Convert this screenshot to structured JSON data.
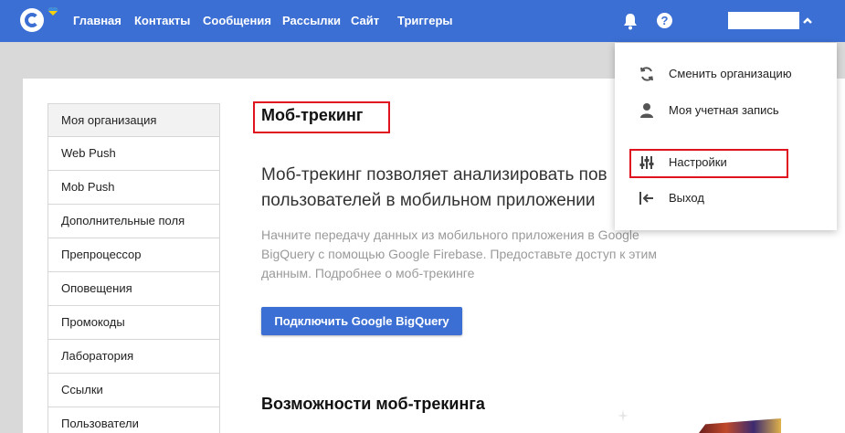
{
  "navbar": {
    "items": [
      {
        "label": "Главная"
      },
      {
        "label": "Контакты"
      },
      {
        "label": "Сообщения"
      },
      {
        "label": "Рассылки"
      },
      {
        "label": "Сайт"
      },
      {
        "label": "Триггеры"
      }
    ],
    "help_glyph": "?",
    "colors": {
      "bar": "#3b6fd4"
    }
  },
  "sidebar": {
    "items": [
      {
        "label": "Моя организация"
      },
      {
        "label": "Web Push"
      },
      {
        "label": "Mob Push"
      },
      {
        "label": "Дополнительные поля"
      },
      {
        "label": "Препроцессор"
      },
      {
        "label": "Оповещения"
      },
      {
        "label": "Промокоды"
      },
      {
        "label": "Лаборатория"
      },
      {
        "label": "Ссылки"
      },
      {
        "label": "Пользователи"
      }
    ]
  },
  "main": {
    "title": "Моб-трекинг",
    "lead": "Моб-трекинг позволяет анализировать пов пользователей в мобильном приложении",
    "description": "Начните передачу данных из мобильного приложения в Google BigQuery с помощью Google Firebase. Предоставьте доступ к этим данным. Подробнее о моб-трекинге",
    "connect_button": "Подключить Google BigQuery",
    "section_title": "Возможности моб-трекинга"
  },
  "dropdown": {
    "items": [
      {
        "label": "Сменить организацию",
        "icon": "sync-icon"
      },
      {
        "label": "Моя учетная запись",
        "icon": "person-icon"
      },
      {
        "label": "Настройки",
        "icon": "sliders-icon"
      },
      {
        "label": "Выход",
        "icon": "logout-icon"
      }
    ]
  },
  "highlight_color": "#e0141e"
}
